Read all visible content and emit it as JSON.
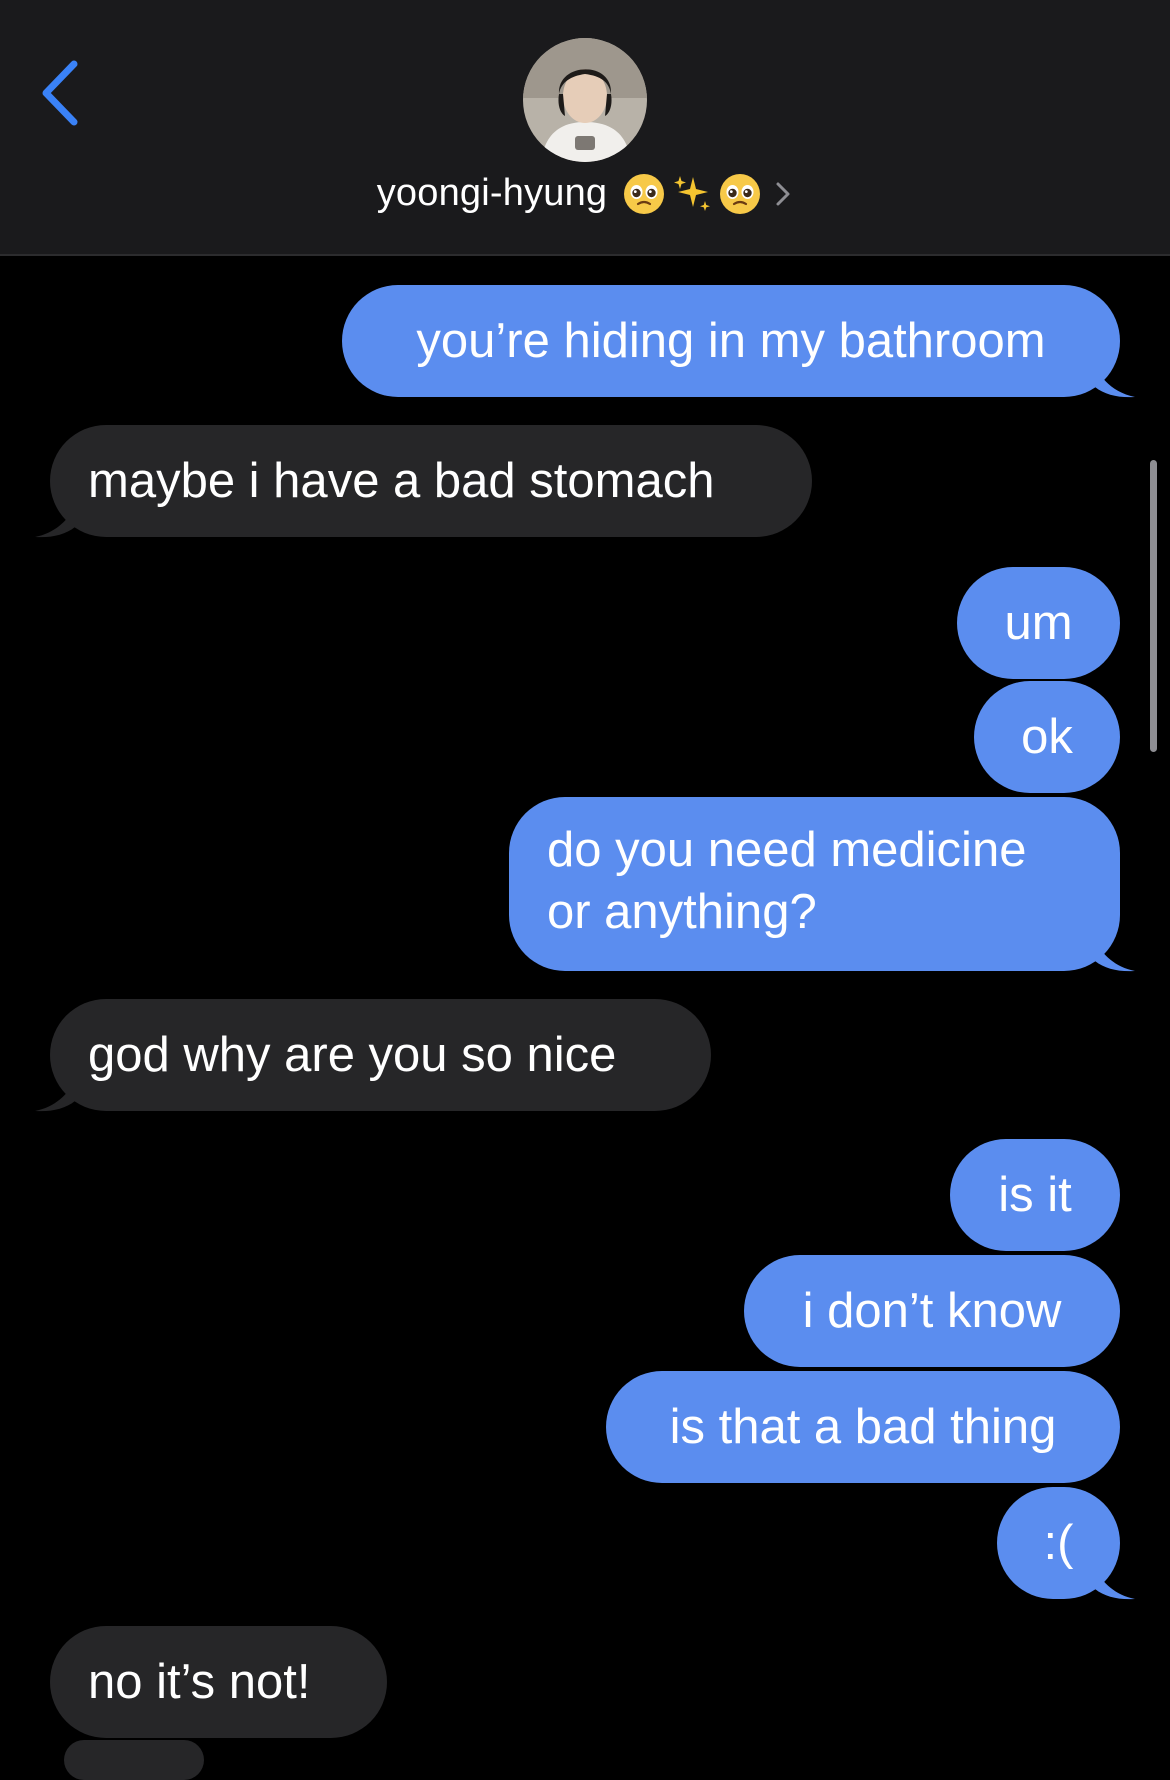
{
  "header": {
    "contact_name": "yoongi-hyung",
    "name_emojis": [
      "pleading-face-emoji",
      "sparkles-emoji",
      "pleading-face-emoji"
    ],
    "back_icon": "chevron-left-icon",
    "details_icon": "chevron-right-icon",
    "accent_color": "#3a82f7"
  },
  "messages": [
    {
      "from": "me",
      "text": "you’re hiding in my bathroom"
    },
    {
      "from": "them",
      "text": "maybe i have a bad stomach"
    },
    {
      "from": "me",
      "text": "um"
    },
    {
      "from": "me",
      "text": "ok"
    },
    {
      "from": "me",
      "text": "do you need medicine or anything?"
    },
    {
      "from": "them",
      "text": "god why are you so nice"
    },
    {
      "from": "me",
      "text": "is it"
    },
    {
      "from": "me",
      "text": "i don’t know"
    },
    {
      "from": "me",
      "text": "is that a bad thing"
    },
    {
      "from": "me",
      "text": ":("
    },
    {
      "from": "them",
      "text": "no it’s not!"
    }
  ],
  "colors": {
    "sent_bubble": "#5b8def",
    "received_bubble": "#262628",
    "background": "#000000",
    "header_bg": "#1a1a1c"
  }
}
